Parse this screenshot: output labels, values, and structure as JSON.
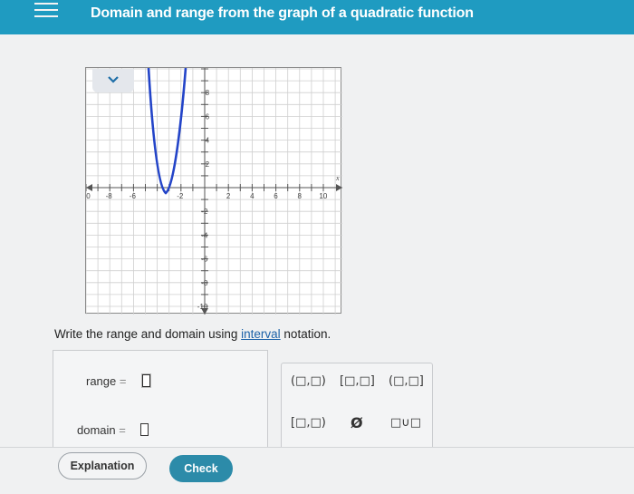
{
  "header": {
    "title": "Domain and range from the graph of a quadratic function"
  },
  "graph": {
    "x_ticks": [
      "-10",
      "-8",
      "-6",
      "-2",
      "2",
      "4",
      "6",
      "8",
      "10"
    ],
    "y_ticks": [
      "8",
      "6",
      "4",
      "2",
      "-2",
      "-4",
      "-6",
      "-8",
      "-10"
    ],
    "x_axis_label": "x"
  },
  "problem": {
    "instruction_prefix": "Write the range and domain using ",
    "instruction_link": "interval",
    "instruction_suffix": " notation."
  },
  "answers": {
    "range_label": "range",
    "domain_label": "domain",
    "equals": "="
  },
  "keypad": {
    "keys": [
      "(□,□)",
      "[□,□]",
      "(□,□]",
      "[□,□)",
      "Ø",
      "□∪□",
      "∞",
      "-∞"
    ]
  },
  "buttons": {
    "explanation": "Explanation",
    "check": "Check"
  }
}
